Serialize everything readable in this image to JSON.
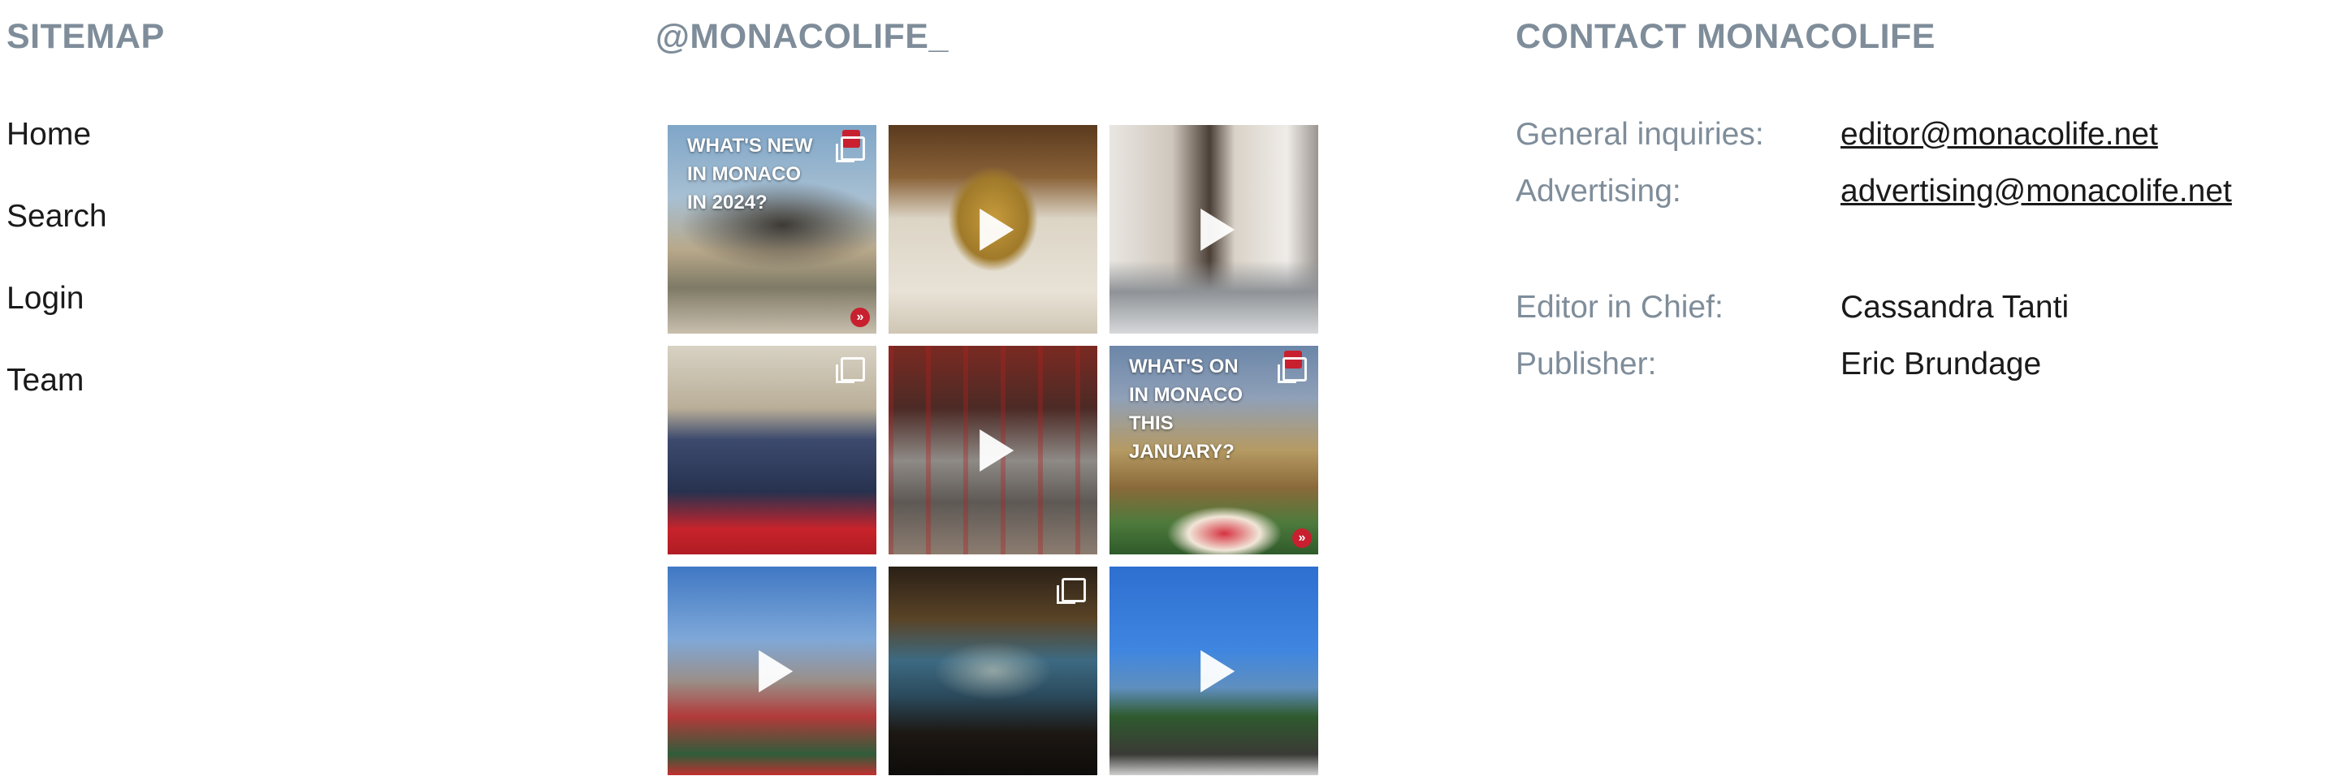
{
  "sitemap": {
    "title": "SITEMAP",
    "items": [
      "Home",
      "Search",
      "Login",
      "Team"
    ]
  },
  "instagram": {
    "title": "@MONACOLIFE_",
    "tiles": [
      {
        "type": "carousel",
        "text": "WHAT'S NEW\nIN MONACO\nIN 2024?"
      },
      {
        "type": "video",
        "text": ""
      },
      {
        "type": "video",
        "text": ""
      },
      {
        "type": "carousel",
        "text": ""
      },
      {
        "type": "video",
        "text": ""
      },
      {
        "type": "carousel",
        "text": "WHAT'S ON\nIN MONACO\nTHIS\nJANUARY?"
      },
      {
        "type": "video",
        "text": ""
      },
      {
        "type": "carousel",
        "text": ""
      },
      {
        "type": "video",
        "text": ""
      }
    ]
  },
  "contact": {
    "title": "CONTACT MONACOLIFE",
    "rows": [
      {
        "label": "General inquiries:",
        "value": "editor@monacolife.net"
      },
      {
        "label": "Advertising:",
        "value": "advertising@monacolife.net"
      },
      {
        "label": "Editor in Chief:",
        "value": "Cassandra Tanti"
      },
      {
        "label": "Publisher:",
        "value": "Eric Brundage"
      }
    ]
  },
  "colors": {
    "heading": "#7f8d9a",
    "text": "#1a1a1a",
    "accent_red": "#c8202f"
  },
  "icons": [
    "play-icon",
    "carousel-icon",
    "double-chevron-icon"
  ]
}
